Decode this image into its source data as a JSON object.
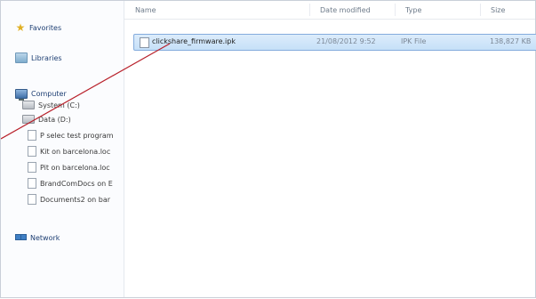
{
  "nav": {
    "favorites": "Favorites",
    "libraries": "Libraries",
    "computer": "Computer",
    "drives": [
      "System (C:)",
      "Data (D:)",
      "P selec test program",
      "Kit on barcelona.loc",
      "Pit on barcelona.loc",
      "BrandComDocs on E",
      "Documents2 on bar"
    ],
    "network": "Network"
  },
  "columns": {
    "name": "Name",
    "date": "Date modified",
    "type": "Type",
    "size": "Size"
  },
  "files": [
    {
      "name": "clickshare_firmware.ipk",
      "date": "21/08/2012 9:52",
      "type": "IPK File",
      "size": "138,827 KB"
    }
  ],
  "colors": {
    "selection": "#cce4f7",
    "selection_border": "#84acdd",
    "pointer_line": "#b8202a"
  }
}
